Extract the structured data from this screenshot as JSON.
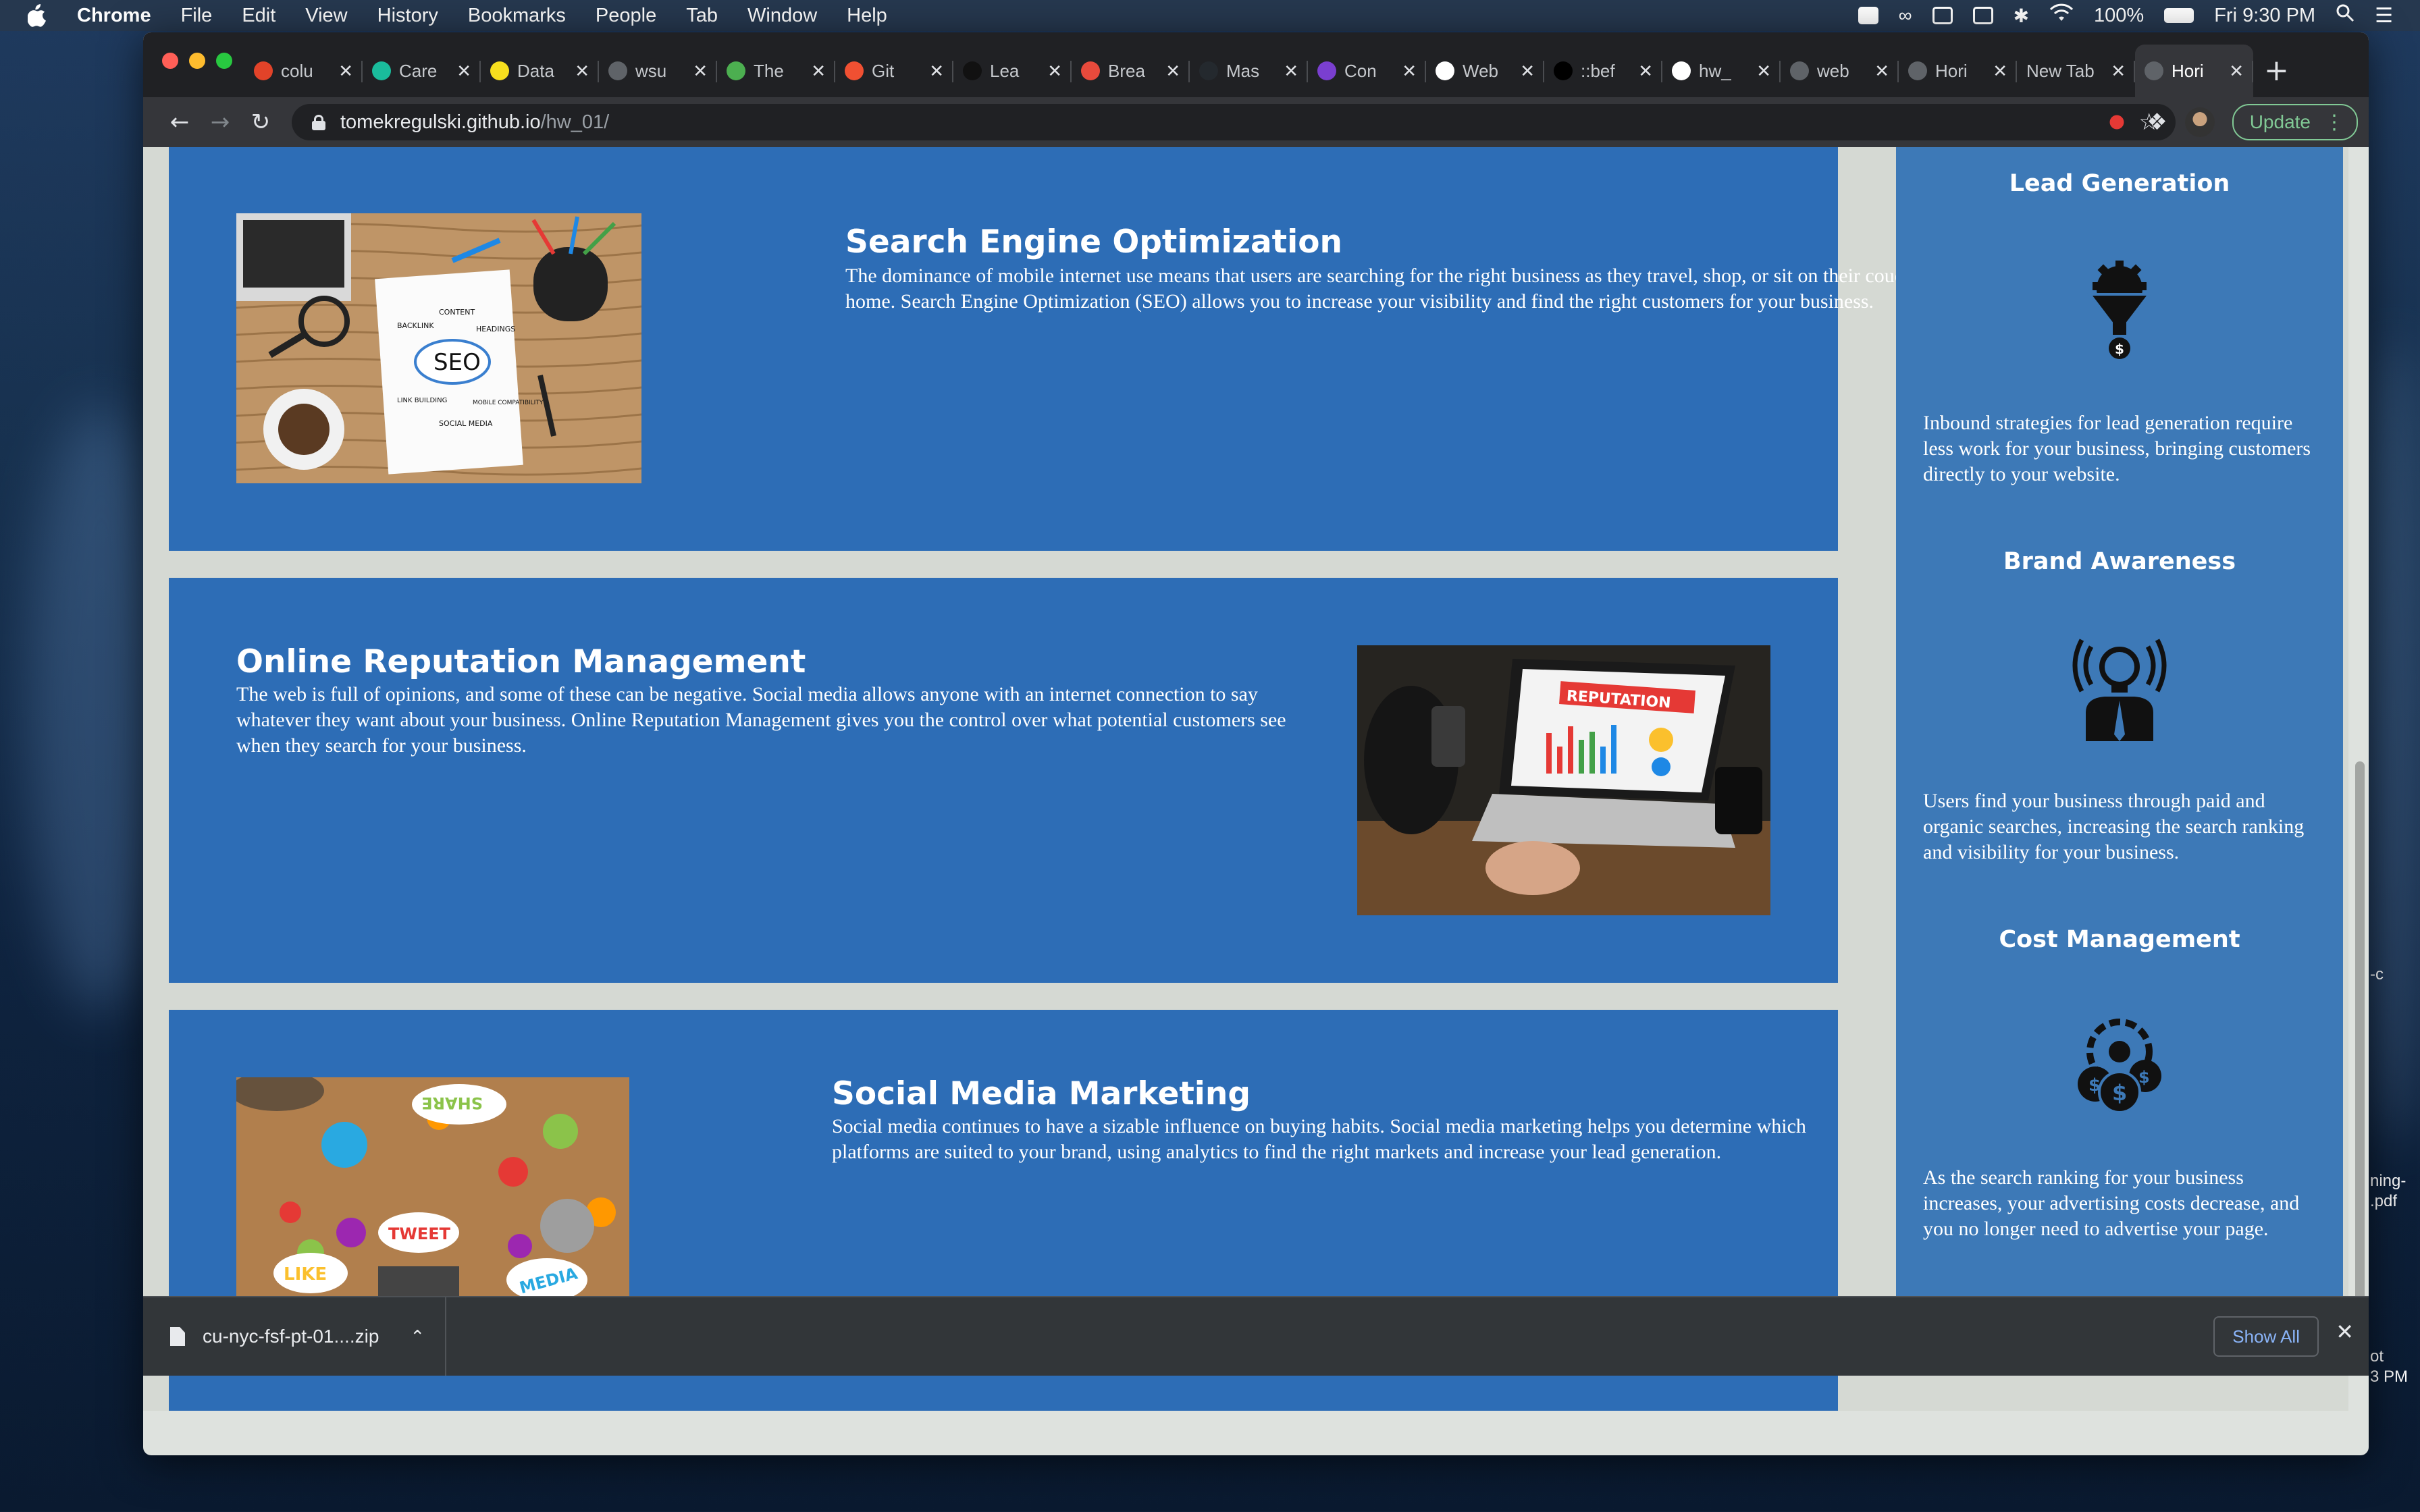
{
  "menubar": {
    "app_name": "Chrome",
    "items": [
      "File",
      "Edit",
      "View",
      "History",
      "Bookmarks",
      "People",
      "Tab",
      "Window",
      "Help"
    ],
    "battery": "100%",
    "clock": "Fri 9:30 PM"
  },
  "browser": {
    "tabs": [
      {
        "label": "colu",
        "icon": "gitlab-icon",
        "color": "#e24329"
      },
      {
        "label": "Care",
        "icon": "s-letter-icon",
        "color": "#1abc9c"
      },
      {
        "label": "Data",
        "icon": "js-icon",
        "color": "#f7df1e"
      },
      {
        "label": "wsu",
        "icon": "globe-icon",
        "color": "#5f6368"
      },
      {
        "label": "The",
        "icon": "leaf-icon",
        "color": "#4caf50"
      },
      {
        "label": "Git",
        "icon": "git-icon",
        "color": "#f05032"
      },
      {
        "label": "Lea",
        "icon": "circle-logo-icon",
        "color": "#111111"
      },
      {
        "label": "Brea",
        "icon": "burst-icon",
        "color": "#e84a3c"
      },
      {
        "label": "Mas",
        "icon": "github-icon",
        "color": "#24292e"
      },
      {
        "label": "Con",
        "icon": "crescent-icon",
        "color": "#7a3fd0"
      },
      {
        "label": "Web",
        "icon": "css-icon",
        "color": "#ffffff"
      },
      {
        "label": "::bef",
        "icon": "bird-icon",
        "color": "#000000"
      },
      {
        "label": "hw_",
        "icon": "github-icon",
        "color": "#ffffff"
      },
      {
        "label": "web",
        "icon": "globe-icon",
        "color": "#5f6368"
      },
      {
        "label": "Hori",
        "icon": "globe-icon",
        "color": "#5f6368"
      },
      {
        "label": "New Tab",
        "icon": "",
        "color": ""
      },
      {
        "label": "Hori",
        "icon": "globe-icon",
        "color": "#5f6368",
        "active": true
      }
    ],
    "url_host": "tomekregulski.github.io",
    "url_path": "/hw_01/",
    "update_label": "Update"
  },
  "page": {
    "sections": [
      {
        "title": "Search Engine Optimization",
        "body": "The dominance of mobile internet use means that users are searching for the right business as they travel, shop, or sit on their couch at home. Search Engine Optimization (SEO) allows you to increase your visibility and find the right customers for your business.",
        "image_words": [
          "CONTENT",
          "BACKLINK",
          "HEADINGS",
          "SEO",
          "LINK BUILDING",
          "MOBILE COMPATIBILITY",
          "SOCIAL MEDIA"
        ]
      },
      {
        "title": "Online Reputation Management",
        "body": "The web is full of opinions, and some of these can be negative. Social media allows anyone with an internet connection to say whatever they want about your business. Online Reputation Management gives you the control over what potential customers see when they search for your business.",
        "image_words": [
          "REPUTATION"
        ]
      },
      {
        "title": "Social Media Marketing",
        "body": "Social media continues to have a sizable influence on buying habits. Social media marketing helps you determine which platforms are suited to your brand, using analytics to find the right markets and increase your lead generation.",
        "image_words": [
          "SHARE",
          "TWEET",
          "LIKE",
          "MEDIA"
        ]
      }
    ],
    "benefits": [
      {
        "title": "Lead Generation",
        "icon": "lead-funnel-icon",
        "body": "Inbound strategies for lead generation require less work for your business, bringing customers directly to your website."
      },
      {
        "title": "Brand Awareness",
        "icon": "bulb-person-icon",
        "body": "Users find your business through paid and organic searches, increasing the search ranking and visibility for your business."
      },
      {
        "title": "Cost Management",
        "icon": "gear-money-icon",
        "body": "As the search ranking for your business increases, your advertising costs decrease, and you no longer need to advertise your page."
      }
    ]
  },
  "downloads": {
    "filename": "cu-nyc-fsf-pt-01....zip",
    "show_all": "Show All"
  },
  "desktop": {
    "label1": "-c",
    "label2a": "ning-",
    "label2b": ".pdf",
    "label3a": "ot",
    "label3b": "3 PM"
  },
  "colors": {
    "card": "#2d6db6",
    "sidebar": "#3d79b7",
    "page_bg": "#d5d9d3"
  }
}
